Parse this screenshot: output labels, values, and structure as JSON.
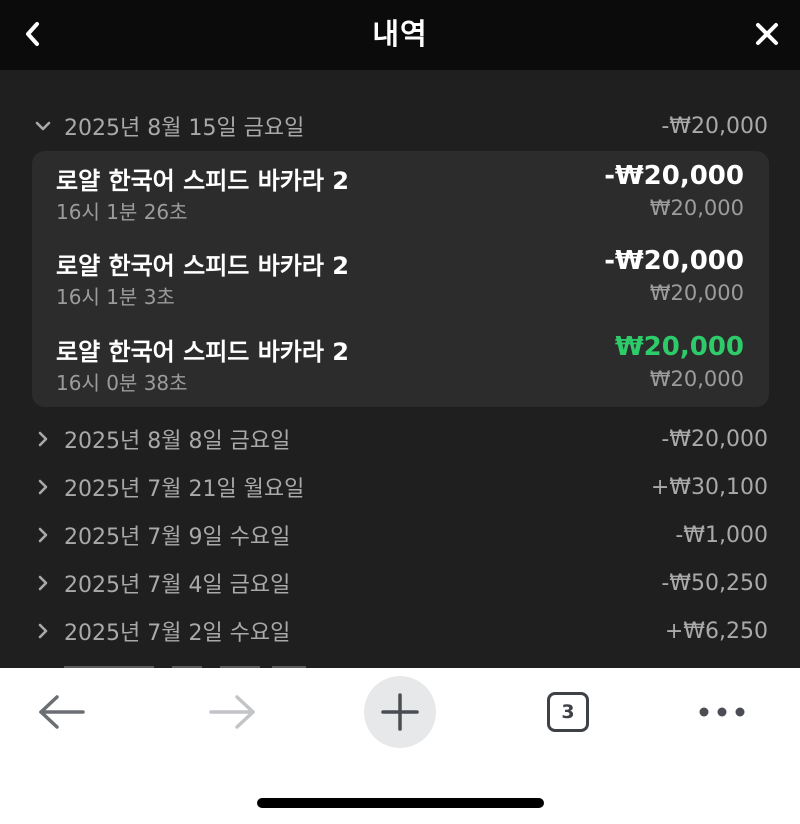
{
  "header": {
    "title": "내역"
  },
  "expanded": {
    "date": "2025년 8월 15일 금요일",
    "total": "-₩20,000",
    "transactions": [
      {
        "name": "로얄 한국어 스피드 바카라 2",
        "time": "16시 1분 26초",
        "amount": "-₩20,000",
        "bet": "₩20,000",
        "result": "loss"
      },
      {
        "name": "로얄 한국어 스피드 바카라 2",
        "time": "16시 1분 3초",
        "amount": "-₩20,000",
        "bet": "₩20,000",
        "result": "loss"
      },
      {
        "name": "로얄 한국어 스피드 바카라 2",
        "time": "16시 0분 38초",
        "amount": "₩20,000",
        "bet": "₩20,000",
        "result": "win"
      }
    ]
  },
  "days": [
    {
      "date": "2025년 8월 8일 금요일",
      "total": "-₩20,000"
    },
    {
      "date": "2025년 7월 21일 월요일",
      "total": "+₩30,100"
    },
    {
      "date": "2025년 7월 9일 수요일",
      "total": "-₩1,000"
    },
    {
      "date": "2025년 7월 4일 금요일",
      "total": "-₩50,250"
    },
    {
      "date": "2025년 7월 2일 수요일",
      "total": "+₩6,250"
    }
  ],
  "toolbar": {
    "tab_count": "3"
  },
  "colors": {
    "win": "#2dcb6a",
    "background": "#1f1f1f",
    "card": "#2c2c2c"
  }
}
